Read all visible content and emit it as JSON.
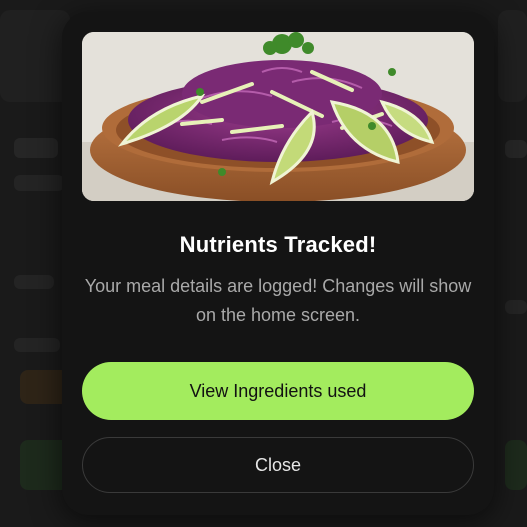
{
  "modal": {
    "title": "Nutrients Tracked!",
    "message": "Your meal details are logged! Changes will show on the home screen.",
    "image": {
      "subject": "purple cabbage and green apple slaw in a wooden bowl"
    },
    "primary_button": {
      "label": "View Ingredients used",
      "color": "#a3ec5e"
    },
    "secondary_button": {
      "label": "Close"
    }
  },
  "colors": {
    "modal_bg": "#141414",
    "title": "#ffffff",
    "message": "#a9a9a9",
    "accent_green": "#a3ec5e"
  }
}
